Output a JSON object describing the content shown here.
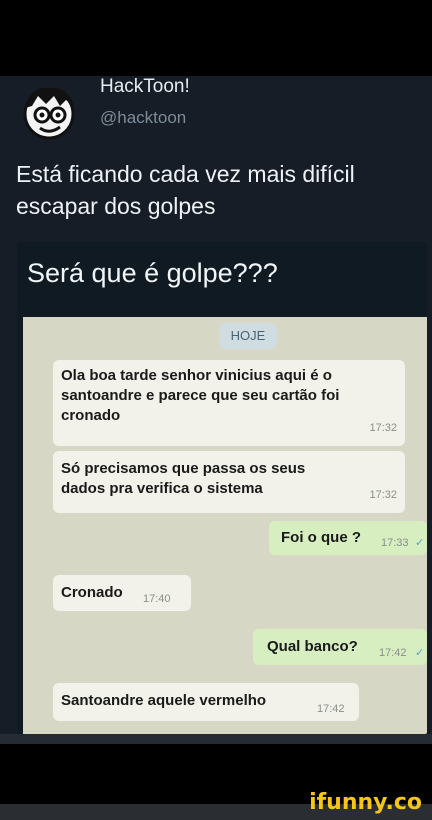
{
  "tweet": {
    "display_name": "HackToon!",
    "handle": "@hacktoon",
    "text": "Está ficando cada vez mais difícil escapar dos golpes"
  },
  "embed": {
    "title": "Será que é golpe???",
    "date_label": "HOJE",
    "messages": [
      {
        "side": "in",
        "text": "Ola boa tarde senhor vinicius aqui é o santoandre e parece que seu cartão foi cronado",
        "time": "17:32"
      },
      {
        "side": "in",
        "text": "Só precisamos que passa os seus dados pra verifica o sistema",
        "time": "17:32"
      },
      {
        "side": "out",
        "text": "Foi o que ?",
        "time": "17:33"
      },
      {
        "side": "in",
        "text": "Cronado",
        "time": "17:40"
      },
      {
        "side": "out",
        "text": "Qual banco?",
        "time": "17:42"
      },
      {
        "side": "in",
        "text": "Santoandre aquele vermelho",
        "time": "17:42"
      }
    ]
  },
  "watermark": "ifunny.co",
  "colors": {
    "background": "#161d26",
    "chat_background": "#d7d7c5",
    "incoming_bubble": "#f2f2ea",
    "outgoing_bubble": "#d7eec0",
    "watermark": "#f5c518"
  }
}
